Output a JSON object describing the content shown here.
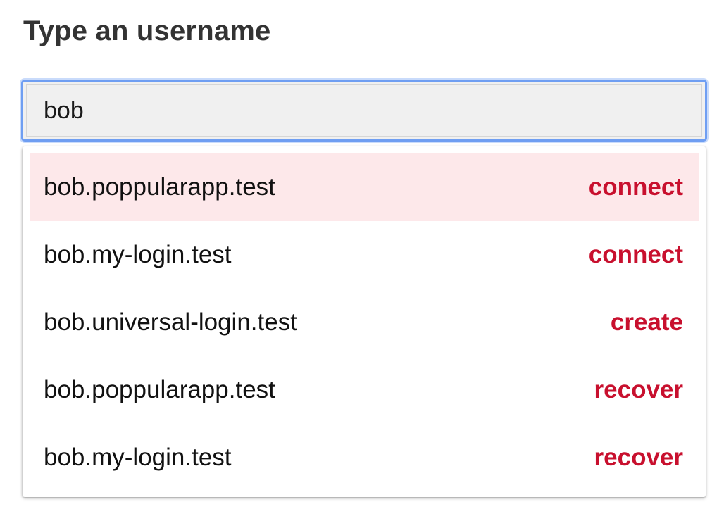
{
  "heading": "Type an username",
  "search": {
    "value": "bob",
    "focus_color": "#6f9ef2"
  },
  "accent_color": "#c8102e",
  "highlight_color": "#fde8ea",
  "options": [
    {
      "name": "bob.poppularapp.test",
      "action": "connect",
      "highlighted": true
    },
    {
      "name": "bob.my-login.test",
      "action": "connect",
      "highlighted": false
    },
    {
      "name": "bob.universal-login.test",
      "action": "create",
      "highlighted": false
    },
    {
      "name": "bob.poppularapp.test",
      "action": "recover",
      "highlighted": false
    },
    {
      "name": "bob.my-login.test",
      "action": "recover",
      "highlighted": false
    }
  ]
}
